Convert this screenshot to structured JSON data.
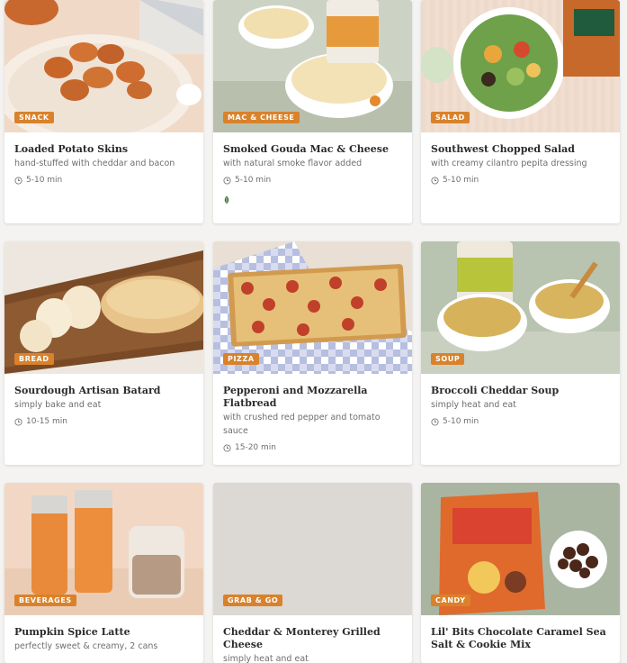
{
  "cards": [
    {
      "tag": "SNACK",
      "title": "Loaded Potato Skins",
      "subtitle": "hand-stuffed with cheddar and bacon",
      "time": "5-10 min"
    },
    {
      "tag": "MAC & CHEESE",
      "title": "Smoked Gouda Mac & Cheese",
      "subtitle": "with natural smoke flavor added",
      "time": "5-10 min",
      "badge_icon": "leaf-icon"
    },
    {
      "tag": "SALAD",
      "title": "Southwest Chopped Salad",
      "subtitle": "with creamy cilantro pepita dressing",
      "time": "5-10 min"
    },
    {
      "tag": "BREAD",
      "title": "Sourdough Artisan Batard",
      "subtitle": "simply bake and eat",
      "time": "10-15 min"
    },
    {
      "tag": "PIZZA",
      "title": "Pepperoni and Mozzarella Flatbread",
      "subtitle": "with crushed red pepper and tomato sauce",
      "time": "15-20 min"
    },
    {
      "tag": "SOUP",
      "title": "Broccoli Cheddar Soup",
      "subtitle": "simply heat and eat",
      "time": "5-10 min"
    },
    {
      "tag": "BEVERAGES",
      "title": "Pumpkin Spice Latte",
      "subtitle": "perfectly sweet & creamy, 2 cans",
      "time": ""
    },
    {
      "tag": "GRAB & GO",
      "title": "Cheddar & Monterey Grilled Cheese",
      "subtitle": "simply heat and eat",
      "time": ""
    },
    {
      "tag": "CANDY",
      "title": "Lil' Bits Chocolate Caramel Sea Salt & Cookie Mix",
      "subtitle": "",
      "time": ""
    }
  ],
  "colors": {
    "tag": "#d9822b",
    "leaf": "#3f7a3a"
  }
}
